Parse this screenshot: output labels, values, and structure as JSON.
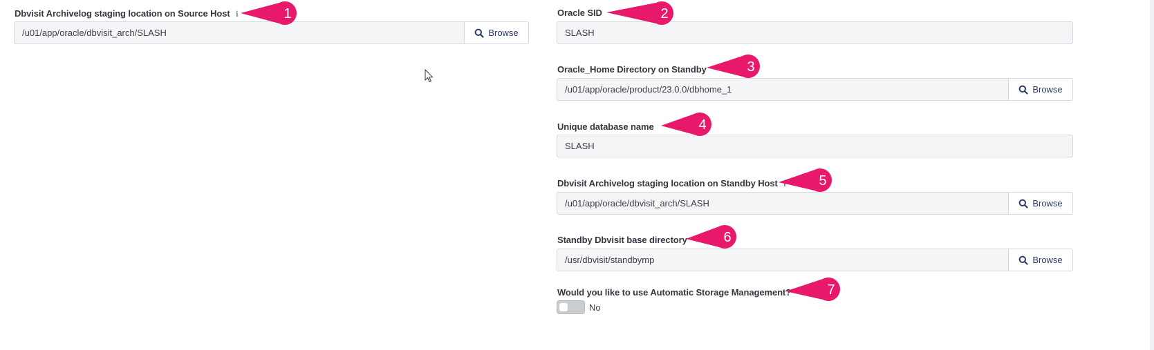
{
  "left": {
    "archivelog_source": {
      "label": "Dbvisit Archivelog staging location on Source Host",
      "info_icon": "ℹ",
      "value": "/u01/app/oracle/dbvisit_arch/SLASH",
      "browse_label": "Browse",
      "marker": "1"
    }
  },
  "right": {
    "oracle_sid": {
      "label": "Oracle SID",
      "value": "SLASH",
      "marker": "2"
    },
    "oracle_home": {
      "label": "Oracle_Home Directory on Standby",
      "value": "/u01/app/oracle/product/23.0.0/dbhome_1",
      "browse_label": "Browse",
      "marker": "3"
    },
    "unique_db_name": {
      "label": "Unique database name",
      "value": "SLASH",
      "marker": "4"
    },
    "archivelog_standby": {
      "label": "Dbvisit Archivelog staging location on Standby Host",
      "info_icon": "ℹ",
      "value": "/u01/app/oracle/dbvisit_arch/SLASH",
      "browse_label": "Browse",
      "marker": "5"
    },
    "standby_base_dir": {
      "label": "Standby Dbvisit base directory",
      "value": "/usr/dbvisit/standbymp",
      "browse_label": "Browse",
      "marker": "6"
    },
    "asm": {
      "label": "Would you like to use Automatic Storage Management?",
      "toggle_state": "No",
      "marker": "7"
    }
  },
  "colors": {
    "marker": "#e8196b",
    "browse_text": "#2b3a67"
  },
  "icons": [
    "info-icon",
    "search-icon",
    "mouse-cursor-icon"
  ]
}
